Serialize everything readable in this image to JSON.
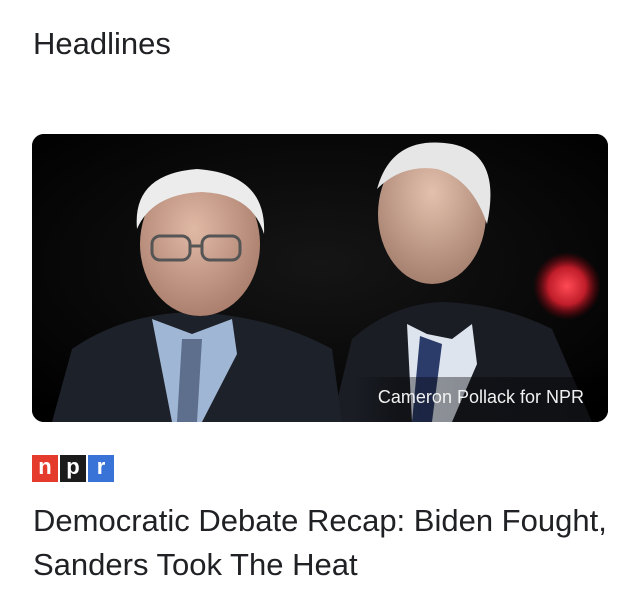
{
  "section": {
    "title": "Headlines"
  },
  "article": {
    "image_credit": "Cameron Pollack for NPR",
    "image_alt_subject": "two-men-at-debate-photo",
    "source_logo_letters": [
      "n",
      "p",
      "r"
    ],
    "source_logo_colors": [
      "#e53b2c",
      "#1b1b1b",
      "#3a73d8"
    ],
    "headline": "Democratic Debate Recap: Biden Fought, Sanders Took The Heat"
  }
}
